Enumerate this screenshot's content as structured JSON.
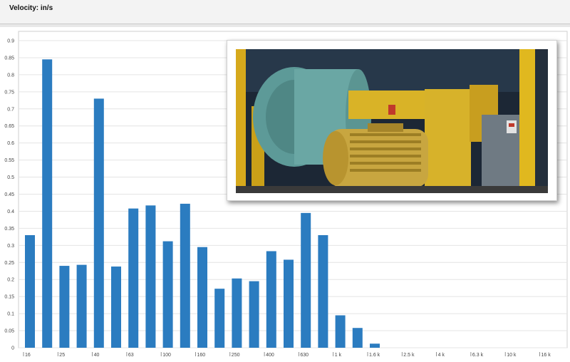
{
  "header": {
    "title": "Velocity: in/s"
  },
  "chart_data": {
    "type": "bar",
    "title": "",
    "xlabel": "",
    "ylabel": "Velocity: in/s",
    "ylim": [
      0,
      0.9
    ],
    "y_ticks": [
      "0",
      "0.05",
      "0.1",
      "0.15",
      "0.2",
      "0.25",
      "0.3",
      "0.35",
      "0.4",
      "0.45",
      "0.5",
      "0.55",
      "0.6",
      "0.65",
      "0.7",
      "0.75",
      "0.8",
      "0.85",
      "0.9"
    ],
    "x_tick_labels": [
      "16",
      "25",
      "40",
      "63",
      "100",
      "160",
      "250",
      "400",
      "630",
      "1 k",
      "1.6 k",
      "2.5 k",
      "4 k",
      "6.3 k",
      "10 k",
      "16 k"
    ],
    "values": [
      0.33,
      0.845,
      0.24,
      0.243,
      0.73,
      0.238,
      0.408,
      0.417,
      0.312,
      0.422,
      0.295,
      0.173,
      0.203,
      0.195,
      0.283,
      0.258,
      0.395,
      0.33,
      0.095,
      0.058,
      0.012
    ],
    "bar_color": "#2b7cc0",
    "grid": true,
    "legend": "none"
  },
  "photo": {
    "description_icon": "motor-blower-photo"
  }
}
